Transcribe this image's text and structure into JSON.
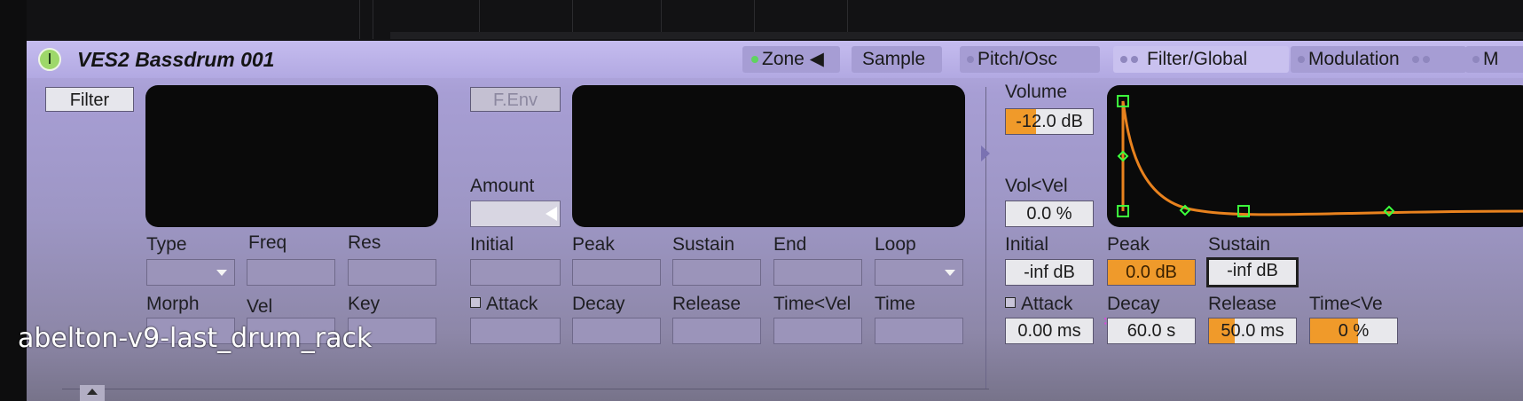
{
  "device": {
    "title": "VES2 Bassdrum 001",
    "tabs": [
      {
        "label": "Zone ◀",
        "indicator": "on"
      },
      {
        "label": "Sample",
        "indicator": "none"
      },
      {
        "label": "Pitch/Osc",
        "indicator": "off"
      },
      {
        "label": "Filter/Global",
        "indicator": "off2",
        "active": true
      },
      {
        "label": "Modulation",
        "indicator": "off"
      },
      {
        "label": "M",
        "indicator": "off"
      }
    ]
  },
  "filter": {
    "button": "Filter",
    "labels": {
      "type": "Type",
      "freq": "Freq",
      "res": "Res",
      "morph": "Morph",
      "vel": "Vel",
      "key": "Key"
    }
  },
  "fenv": {
    "button": "F.Env",
    "amount_label": "Amount",
    "labels": {
      "initial": "Initial",
      "peak": "Peak",
      "sustain": "Sustain",
      "end": "End",
      "loop": "Loop",
      "attack": "Attack",
      "decay": "Decay",
      "release": "Release",
      "time_vel": "Time<Vel",
      "time": "Time"
    }
  },
  "amp": {
    "volume_label": "Volume",
    "volume_value": "-12.0 dB",
    "volume_fill_fraction": 0.35,
    "vol_vel_label": "Vol<Vel",
    "vol_vel_value": "0.0 %",
    "initial_label": "Initial",
    "initial_value": "-inf dB",
    "peak_label": "Peak",
    "peak_value": "0.0 dB",
    "sustain_label": "Sustain",
    "sustain_value": "-inf dB",
    "attack_label": "Attack",
    "attack_value": "0.00 ms",
    "decay_label": "Decay",
    "decay_value": "60.0 s",
    "release_label": "Release",
    "release_value": "50.0 ms",
    "release_fill_fraction": 0.3,
    "time_vel_label": "Time<Ve",
    "time_vel_value": "0 %",
    "time_vel_fill_fraction": 0.55,
    "envelope_color": "#e8821e",
    "node_color": "#3cff3c"
  },
  "caption": "abelton-v9-last_drum_rack"
}
